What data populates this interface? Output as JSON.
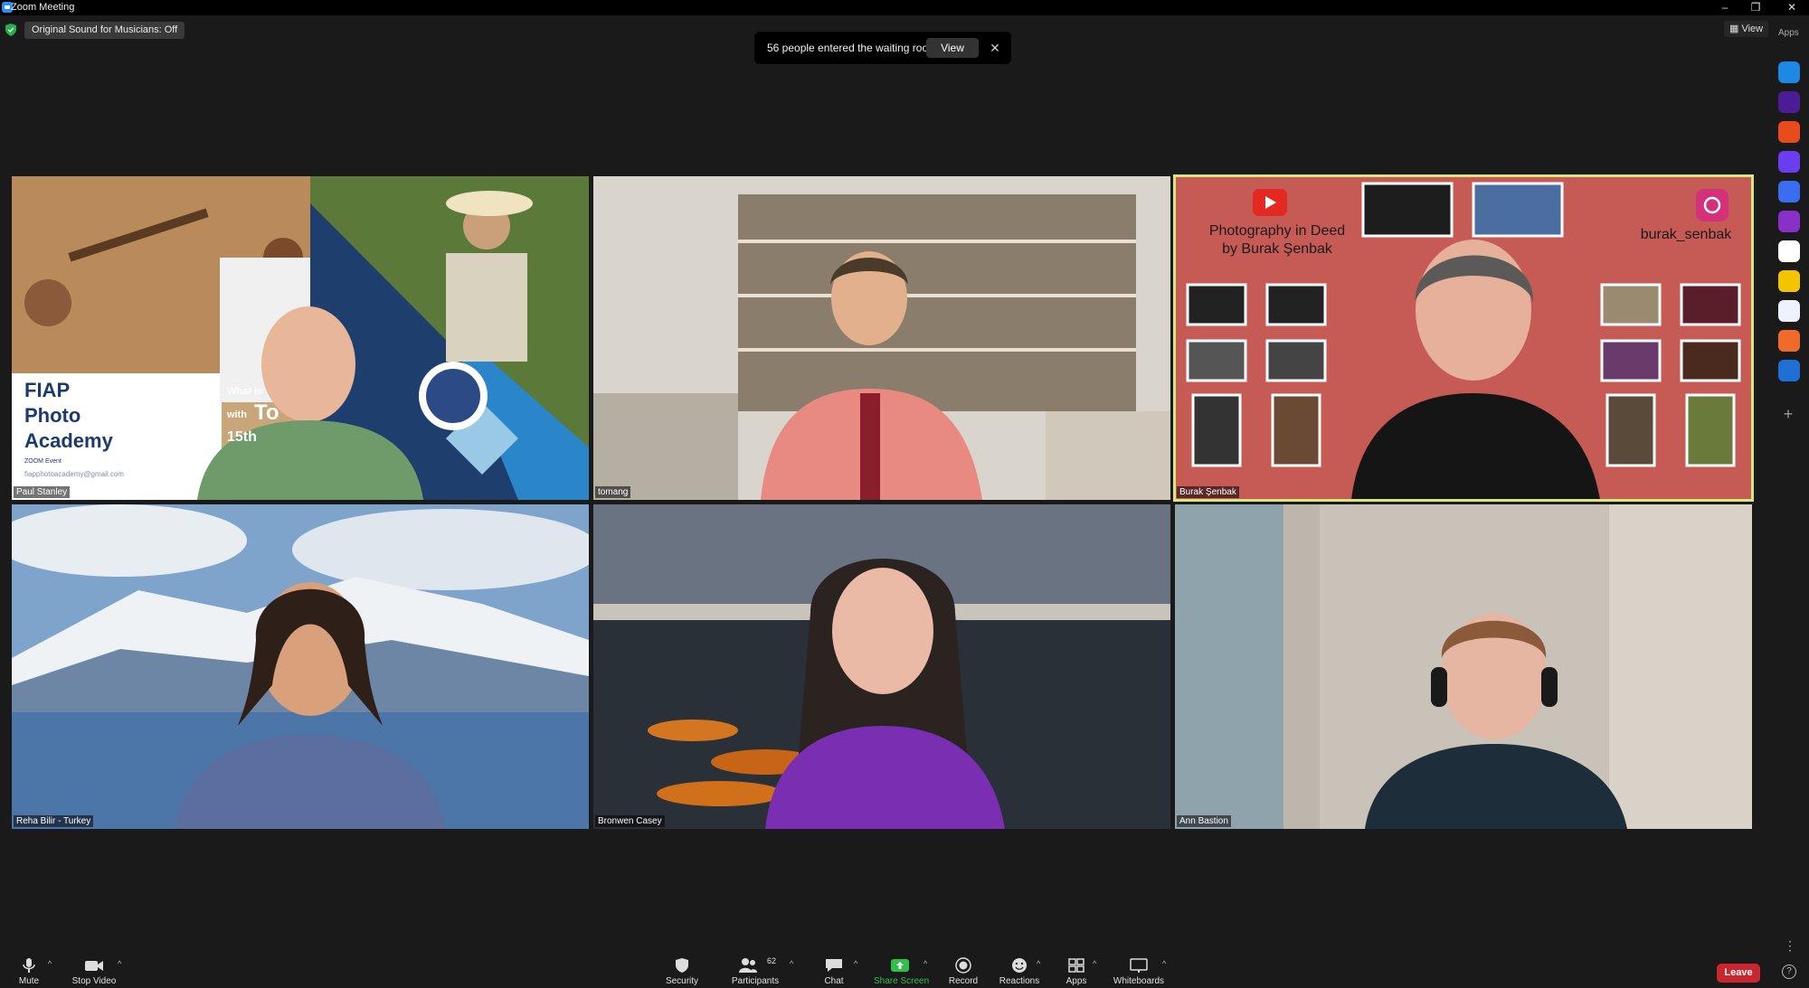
{
  "window": {
    "title": "Zoom Meeting"
  },
  "status": {
    "original_sound": "Original Sound for Musicians: Off"
  },
  "banner": {
    "text": "56 people entered the waiting room",
    "view_label": "View",
    "close_glyph": "✕"
  },
  "top_right": {
    "view_label": "View",
    "apps_label": "Apps"
  },
  "app_rail": {
    "icons": [
      {
        "name": "arrow-app-icon",
        "color": "#1e88e5"
      },
      {
        "name": "kahoot-app-icon",
        "color": "#4a1d96"
      },
      {
        "name": "orange-app-icon",
        "color": "#e84c1b"
      },
      {
        "name": "w-app-icon",
        "color": "#6b3df0"
      },
      {
        "name": "blue-swirl-app-icon",
        "color": "#3a6df0"
      },
      {
        "name": "purple-app-icon",
        "color": "#8b2fc9"
      },
      {
        "name": "scribble-app-icon",
        "color": "#ffffff"
      },
      {
        "name": "yellow-face-app-icon",
        "color": "#f5c400"
      },
      {
        "name": "twine-app-icon",
        "color": "#eef2ff"
      },
      {
        "name": "grid-app-icon",
        "color": "#f06a2a"
      },
      {
        "name": "sync-app-icon",
        "color": "#1f6fd6"
      }
    ]
  },
  "participants": [
    {
      "name": "Paul Stanley"
    },
    {
      "name": "tomang"
    },
    {
      "name": "Burak Şenbak"
    },
    {
      "name": "Reha Bilir - Turkey"
    },
    {
      "name": "Bronwen Casey"
    },
    {
      "name": "Ann Bastion"
    }
  ],
  "slide": {
    "line1": "FIAP",
    "line2": "Photo",
    "line3": "Academy",
    "what": "What is",
    "with": "with",
    "t": "To",
    "date": "15th",
    "zoom": "ZOOM Event",
    "email": "fiapphotoacademy@gmail.com"
  },
  "burak_bg": {
    "title1": "Photography in Deed",
    "title2": "by Burak Şenbak",
    "handle": "burak_senbak"
  },
  "toolbar": {
    "mute": "Mute",
    "stop_video": "Stop Video",
    "security": "Security",
    "participants": "Participants",
    "participants_count": "62",
    "chat": "Chat",
    "share_screen": "Share Screen",
    "record": "Record",
    "reactions": "Reactions",
    "apps": "Apps",
    "whiteboards": "Whiteboards",
    "leave": "Leave"
  },
  "colors": {
    "speaker_outline": "#d9e67a",
    "share_green": "#2fbf4b",
    "leave_red": "#c8272d"
  }
}
